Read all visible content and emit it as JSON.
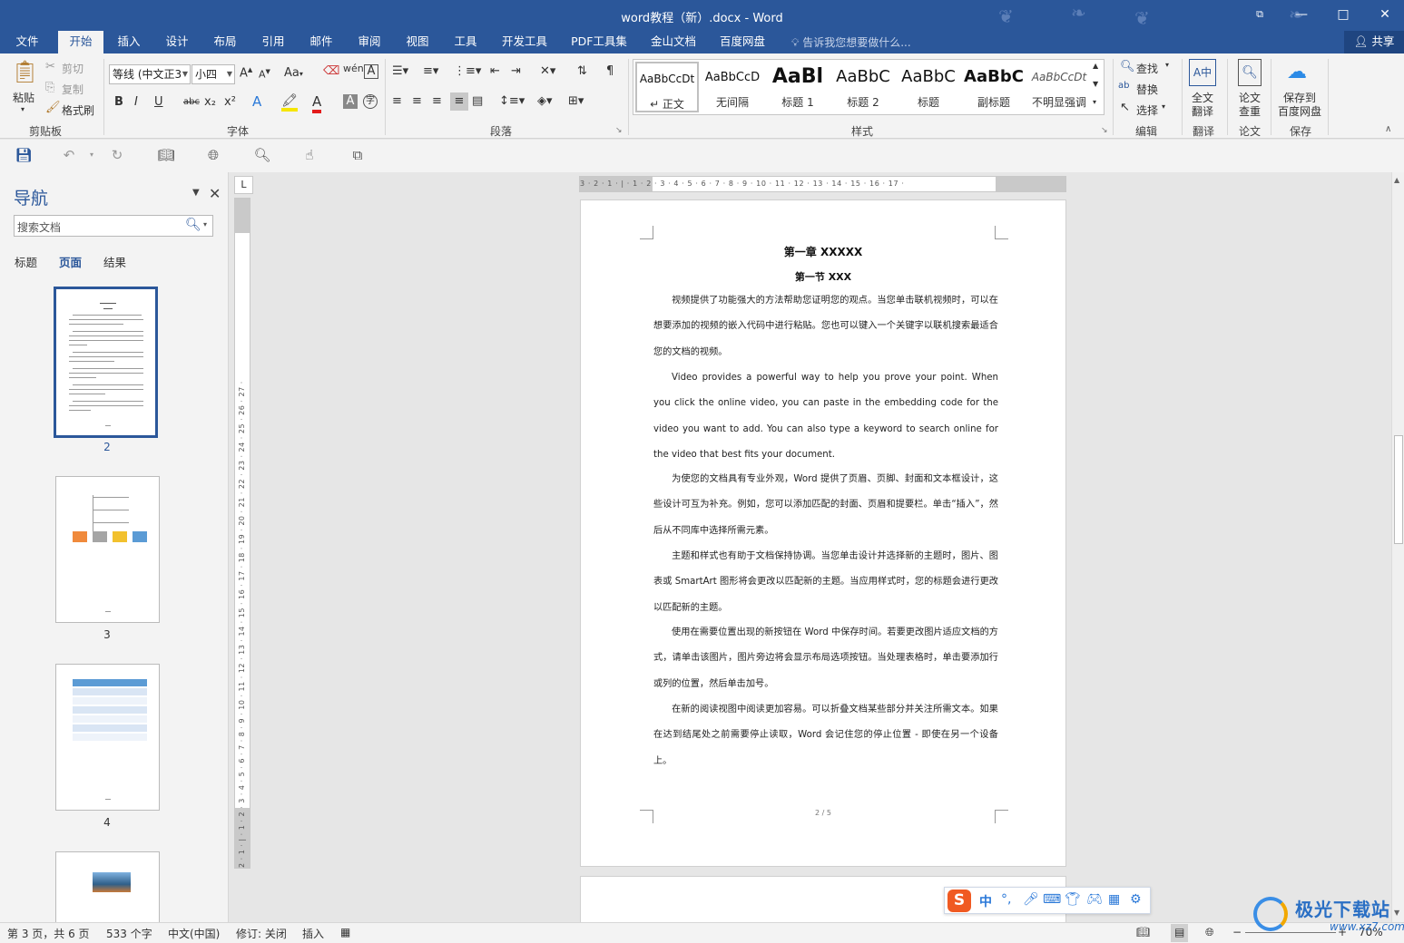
{
  "window": {
    "title": "word教程（新）.docx - Word",
    "restore_icon": "restore-window-icon",
    "controls": {
      "minimize": "—",
      "maximize": "□",
      "close": "✕"
    }
  },
  "ribbon_tabs": [
    "文件",
    "开始",
    "插入",
    "设计",
    "布局",
    "引用",
    "邮件",
    "审阅",
    "视图",
    "工具",
    "开发工具",
    "PDF工具集",
    "金山文档",
    "百度网盘"
  ],
  "active_tab": "开始",
  "tell_me": "告诉我您想要做什么...",
  "share": "共享",
  "clipboard": {
    "paste": "粘贴",
    "cut": "剪切",
    "copy": "复制",
    "format_painter": "格式刷",
    "group": "剪贴板"
  },
  "font": {
    "name": "等线 (中文正文)",
    "name_shown": "等线 (中文正3",
    "size": "小四",
    "group": "字体",
    "change_case": "Aa",
    "buttons": [
      "B",
      "I",
      "U",
      "abc",
      "x₂",
      "x²"
    ]
  },
  "paragraph": {
    "group": "段落"
  },
  "styles": {
    "group": "样式",
    "items": [
      {
        "sample": "AaBbCcDt",
        "name": "↵ 正文",
        "selected": true
      },
      {
        "sample": "AaBbCcD",
        "name": "无间隔"
      },
      {
        "sample": "AaBl",
        "name": "标题 1"
      },
      {
        "sample": "AaBbC",
        "name": "标题 2"
      },
      {
        "sample": "AaBbC",
        "name": "标题"
      },
      {
        "sample": "AaBbC",
        "name": "副标题"
      },
      {
        "sample": "AaBbCcDt",
        "name": "不明显强调"
      }
    ]
  },
  "editing": {
    "find": "查找",
    "replace": "替换",
    "select": "选择",
    "group": "编辑"
  },
  "translate": {
    "full": "全文",
    "full2": "翻译",
    "group": "翻译"
  },
  "paper": {
    "label1": "论文",
    "label2": "查重",
    "group": "论文"
  },
  "save_baidu": {
    "label1": "保存到",
    "label2": "百度网盘",
    "group": "保存"
  },
  "nav": {
    "title": "导航",
    "search_placeholder": "搜索文档",
    "tabs": [
      "标题",
      "页面",
      "结果"
    ],
    "active_tab": "页面",
    "pages": [
      "2",
      "3",
      "4"
    ],
    "active_page": "2"
  },
  "ruler": {
    "h_numbers": "3 · 2 · 1 · | · 1 · 2 · 3 · 4 · 5 · 6 · 7 · 8 · 9 · 10 · 11 · 12 · 13 · 14 · 15 · 16 · 17 ·",
    "v_numbers": "2 · 1 · | · 1 · 2 · 3 · 4 · 5 · 6 · 7 · 8 · 9 · 10 · 11 · 12 · 13 · 14 · 15 · 16 · 17 · 18 · 19 · 20 · 21 · 22 · 23 · 24 · 25 · 26 · 27 ·",
    "tab_stop": "L"
  },
  "document": {
    "chapter": "第一章  XXXXX",
    "section": "第一节  XXX",
    "paragraphs": [
      "视频提供了功能强大的方法帮助您证明您的观点。当您单击联机视频时，可以在想要添加的视频的嵌入代码中进行粘贴。您也可以键入一个关键字以联机搜索最适合您的文档的视频。",
      "Video provides a powerful way to help you prove your point. When you click the online video, you can paste in the embedding code for the video you want to add. You can also type a keyword to search online for the video that best fits your document.",
      "为使您的文档具有专业外观，Word 提供了页眉、页脚、封面和文本框设计，这些设计可互为补充。例如，您可以添加匹配的封面、页眉和提要栏。单击“插入”，然后从不同库中选择所需元素。",
      "主题和样式也有助于文档保持协调。当您单击设计并选择新的主题时，图片、图表或 SmartArt 图形将会更改以匹配新的主题。当应用样式时，您的标题会进行更改以匹配新的主题。",
      "使用在需要位置出现的新按钮在 Word 中保存时间。若要更改图片适应文档的方式，请单击该图片，图片旁边将会显示布局选项按钮。当处理表格时，单击要添加行或列的位置，然后单击加号。",
      "在新的阅读视图中阅读更加容易。可以折叠文档某些部分并关注所需文本。如果在达到结尾处之前需要停止读取，Word 会记住您的停止位置 - 即使在另一个设备上。"
    ],
    "footer": "2 / 5"
  },
  "status": {
    "page": "第 3 页，共 6 页",
    "words": "533 个字",
    "language": "中文(中国)",
    "revision": "修订: 关闭",
    "mode": "插入",
    "zoom": "70%",
    "zoom_minus": "−",
    "zoom_plus": "+"
  },
  "ime": {
    "logo": "S",
    "lang": "中",
    "punct": "°,"
  },
  "watermark": {
    "text": "极光下载站",
    "url": "www.xz7.com"
  },
  "colors": {
    "accent": "#2b579a",
    "ribbon_bg": "#f3f3f3",
    "doc_bg": "#e6e6e6"
  }
}
